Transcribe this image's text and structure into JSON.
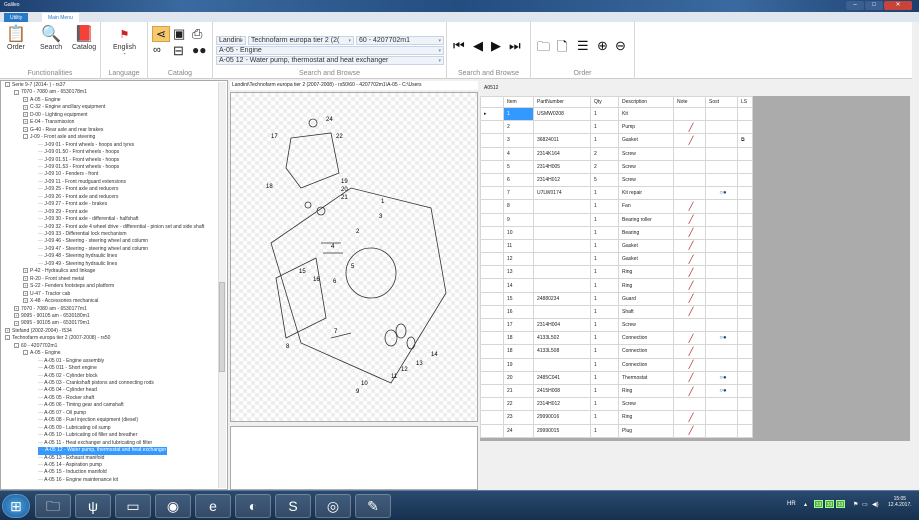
{
  "window": {
    "title": "Galileo"
  },
  "tabs": [
    "Utility",
    "Main Menu"
  ],
  "ribbon": {
    "functionalities": {
      "label": "Functionalities",
      "buttons": [
        "Order",
        "Search",
        "Catalog"
      ]
    },
    "language": {
      "label": "Language",
      "value": "English",
      "sub": "-"
    },
    "catalog": {
      "label": "Catalog"
    },
    "search_browse": {
      "label": "Search and Browse",
      "brand": "Landini",
      "model": "Technofarm europa tier 2 (2(",
      "version": "60 - 4207702m1",
      "group": "A-05 - Engine",
      "section": "A-05 12 - Water pump, thermostat and heat exchanger"
    },
    "nav": {
      "label": "Search and Browse"
    },
    "order": {
      "label": "Order"
    }
  },
  "tree": [
    [
      1,
      "-",
      "Serie 9-7 (2014-   ) - rs37"
    ],
    [
      2,
      "-",
      "7070 - 7080 am - 6530178m1"
    ],
    [
      3,
      "+",
      "A-05 - Engine"
    ],
    [
      3,
      "+",
      "C-32 - Engine ancillary equipment"
    ],
    [
      3,
      "+",
      "D-00 - Lighting equipment"
    ],
    [
      3,
      "+",
      "E-04 - Transmission"
    ],
    [
      3,
      "+",
      "G-40 - Rear axle and rear brakes"
    ],
    [
      3,
      "-",
      "J-09 - Front axle and steering"
    ],
    [
      4,
      "",
      "J-09 01 - Front wheels - hoops and tyres"
    ],
    [
      4,
      "",
      "J-09 01.50 - Front wheels - hoops"
    ],
    [
      4,
      "",
      "J-09 01.51 - Front wheels - hoops"
    ],
    [
      4,
      "",
      "J-09 01.53 - Front wheels - hoops"
    ],
    [
      4,
      "",
      "J-09 10 - Fenders - front"
    ],
    [
      4,
      "",
      "J-09 11 - Front mudguard extensions"
    ],
    [
      4,
      "",
      "J-09 25 - Front axle and reducers"
    ],
    [
      4,
      "",
      "J-09 26 - Front axle and reducers"
    ],
    [
      4,
      "",
      "J-09 27 - Front axle - brakes"
    ],
    [
      4,
      "",
      "J-09 29 - Front axle"
    ],
    [
      4,
      "",
      "J-09 30 - Front axle - differential - halfshaft"
    ],
    [
      4,
      "",
      "J-09 32 - Front axle 4 wheel drive - differential - pinion set and side shaft"
    ],
    [
      4,
      "",
      "J-09 33 - Differential lock mechanism"
    ],
    [
      4,
      "",
      "J-09 46 - Steering - steering wheel and column"
    ],
    [
      4,
      "",
      "J-09 47 - Steering - steering wheel and column"
    ],
    [
      4,
      "",
      "J-09 48 - Steering hydraulic lines"
    ],
    [
      4,
      "",
      "J-09 49 - Steering hydraulic lines"
    ],
    [
      3,
      "+",
      "P-42 - Hydraulics and linkage"
    ],
    [
      3,
      "+",
      "R-20 - Front sheet metal"
    ],
    [
      3,
      "+",
      "S-22 - Fenders footsteps and platform"
    ],
    [
      3,
      "+",
      "U-47 - Tractor cab"
    ],
    [
      3,
      "+",
      "X-48 - Accessories mechanical"
    ],
    [
      2,
      "+",
      "7070 - 7080 am - 6530177m1"
    ],
    [
      2,
      "+",
      "9095 - 90105 am - 6530180m1"
    ],
    [
      2,
      "+",
      "9095 - 90105 am - 6530179m1"
    ],
    [
      1,
      "+",
      "Stefand (2002-2004) - l534"
    ],
    [
      1,
      "-",
      "Technofarm europa tier 2 (2007-2008) - rs50"
    ],
    [
      2,
      "-",
      "60 - 4207702m1"
    ],
    [
      3,
      "-",
      "A-05 - Engine"
    ],
    [
      4,
      "",
      "A-05 01 - Engine assembly"
    ],
    [
      4,
      "",
      "A-05 011 - Short engine"
    ],
    [
      4,
      "",
      "A-05 02 - Cylinder block"
    ],
    [
      4,
      "",
      "A-05 03 - Crankshaft pistons and connecting rods"
    ],
    [
      4,
      "",
      "A-05 04 - Cylinder head"
    ],
    [
      4,
      "",
      "A-05 05 - Rocker shaft"
    ],
    [
      4,
      "",
      "A-05 06 - Timing gear and camshaft"
    ],
    [
      4,
      "",
      "A-05 07 - Oil pump"
    ],
    [
      4,
      "",
      "A-05 08 - Fuel injection equipment (diesel)"
    ],
    [
      4,
      "",
      "A-05 09 - Lubricating oil sump"
    ],
    [
      4,
      "",
      "A-05 10 - Lubricating oil filler and breather"
    ],
    [
      4,
      "",
      "A-05 11 - Heat exchanger and lubricating oil filter"
    ],
    [
      4,
      "sel",
      "A-05 12 - Water pump, thermostat and heat exchanger"
    ],
    [
      4,
      "",
      "A-05 13 - Exhaust manifold"
    ],
    [
      4,
      "",
      "A-05 14 - Aspiration pump"
    ],
    [
      4,
      "",
      "A-05 15 - Induction manifold"
    ],
    [
      4,
      "",
      "A-05 16 - Engine maintenance kit"
    ]
  ],
  "path": "Landini\\Technofarm europa tier 2 (2007-2008) - rs50\\60 - 4207702m1\\A-05 -    C:\\Users",
  "drawing": {
    "callouts": [
      "24",
      "17",
      "22",
      "18",
      "19",
      "20",
      "21",
      "1",
      "2",
      "3",
      "4",
      "5",
      "15",
      "16",
      "6",
      "7",
      "8",
      "9",
      "10",
      "11",
      "12",
      "13",
      "14"
    ]
  },
  "section_id": "A0512",
  "table": {
    "headers": [
      "Item",
      "PartNumber",
      "Qty",
      "Description",
      "Note",
      "Sost",
      "LS"
    ],
    "rows": [
      [
        "1",
        "USMW0208",
        "1",
        "Kit",
        "",
        "",
        ""
      ],
      [
        "2",
        "",
        "1",
        "Pump",
        "note",
        "",
        ""
      ],
      [
        "3",
        "36824011",
        "1",
        "Gasket",
        "note",
        "",
        "ls"
      ],
      [
        "4",
        "2314K164",
        "2",
        "Screw",
        "",
        "",
        ""
      ],
      [
        "5",
        "2314H005",
        "2",
        "Screw",
        "",
        "",
        ""
      ],
      [
        "6",
        "2314H012",
        "5",
        "Screw",
        "",
        "",
        ""
      ],
      [
        "7",
        "U7LW0174",
        "1",
        "Kit repair",
        "",
        "sost",
        ""
      ],
      [
        "8",
        "",
        "1",
        "Fan",
        "note",
        "",
        ""
      ],
      [
        "9",
        "",
        "1",
        "Bearing roller",
        "note",
        "",
        ""
      ],
      [
        "10",
        "",
        "1",
        "Bearing",
        "note",
        "",
        ""
      ],
      [
        "11",
        "",
        "1",
        "Gasket",
        "note",
        "",
        ""
      ],
      [
        "12",
        "",
        "1",
        "Gasket",
        "note",
        "",
        ""
      ],
      [
        "13",
        "",
        "1",
        "Ring",
        "note",
        "",
        ""
      ],
      [
        "14",
        "",
        "1",
        "Ring",
        "note",
        "",
        ""
      ],
      [
        "15",
        "24880234",
        "1",
        "Guard",
        "note",
        "",
        ""
      ],
      [
        "16",
        "",
        "1",
        "Shaft",
        "note",
        "",
        ""
      ],
      [
        "17",
        "2314H004",
        "1",
        "Screw",
        "",
        "",
        ""
      ],
      [
        "18",
        "4133L502",
        "1",
        "Connection",
        "note",
        "sost",
        ""
      ],
      [
        "18",
        "4133L508",
        "1",
        "Connection",
        "note",
        "",
        ""
      ],
      [
        "19",
        "",
        "1",
        "Connection",
        "note",
        "",
        ""
      ],
      [
        "20",
        "2485C041",
        "1",
        "Thermostat",
        "note",
        "sost",
        ""
      ],
      [
        "21",
        "2415H008",
        "1",
        "Ring",
        "note",
        "sost",
        ""
      ],
      [
        "22",
        "2314H012",
        "1",
        "Screw",
        "",
        "",
        ""
      ],
      [
        "23",
        "29990016",
        "1",
        "Ring",
        "note",
        "",
        ""
      ],
      [
        "24",
        "29990015",
        "1",
        "Plug",
        "note",
        "",
        ""
      ]
    ]
  },
  "taskbar": {
    "lang": "HR",
    "tray": [
      "33",
      "33",
      "33"
    ],
    "time": "15:05",
    "date": "12.4.2017."
  },
  "colors": {
    "selection": "#3399ff",
    "note": "#b01c1c",
    "titlebar": "#1d3f6e"
  }
}
